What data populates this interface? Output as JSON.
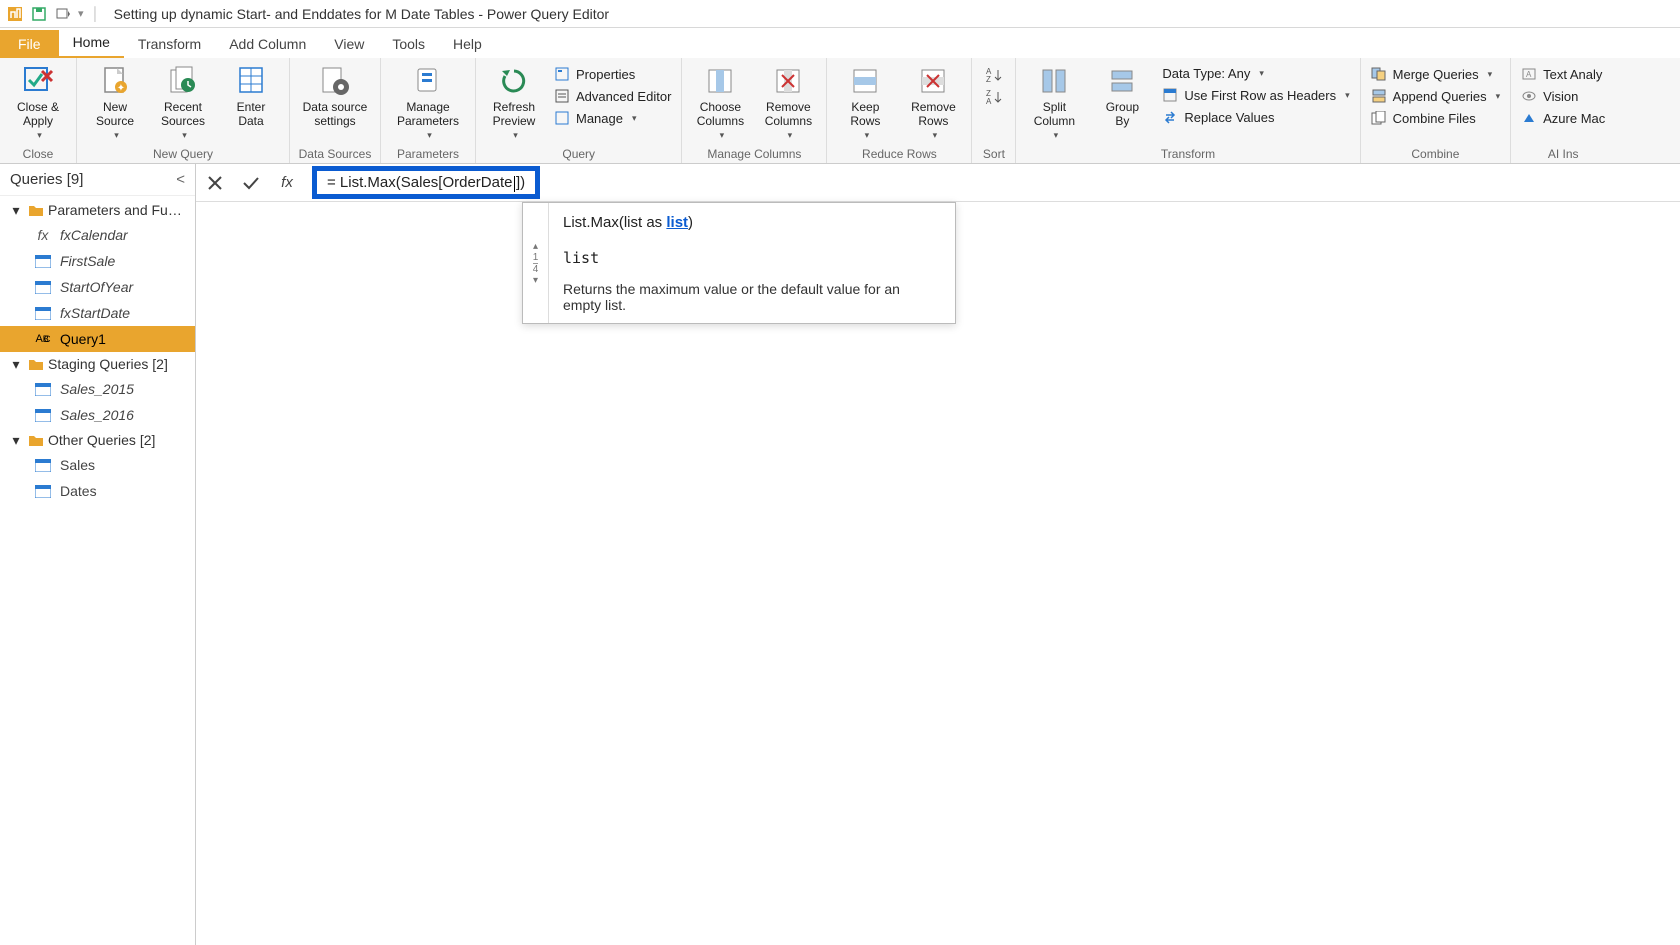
{
  "titlebar": {
    "title": "Setting up dynamic Start- and Enddates for M Date Tables - Power Query Editor"
  },
  "tabs": {
    "file": "File",
    "home": "Home",
    "transform": "Transform",
    "add_column": "Add Column",
    "view": "View",
    "tools": "Tools",
    "help": "Help"
  },
  "ribbon": {
    "close": {
      "close_apply": "Close &\nApply",
      "group": "Close"
    },
    "new_query": {
      "new_source": "New\nSource",
      "recent_sources": "Recent\nSources",
      "enter_data": "Enter\nData",
      "group": "New Query"
    },
    "data_sources": {
      "settings": "Data source\nsettings",
      "group": "Data Sources"
    },
    "parameters": {
      "manage": "Manage\nParameters",
      "group": "Parameters"
    },
    "query": {
      "refresh": "Refresh\nPreview",
      "properties": "Properties",
      "advanced": "Advanced Editor",
      "manage": "Manage",
      "group": "Query"
    },
    "manage_columns": {
      "choose": "Choose\nColumns",
      "remove": "Remove\nColumns",
      "group": "Manage Columns"
    },
    "reduce_rows": {
      "keep": "Keep\nRows",
      "remove": "Remove\nRows",
      "group": "Reduce Rows"
    },
    "sort": {
      "group": "Sort"
    },
    "transform_grp": {
      "split": "Split\nColumn",
      "group_by": "Group\nBy",
      "datatype": "Data Type: Any",
      "first_row": "Use First Row as Headers",
      "replace": "Replace Values",
      "group": "Transform"
    },
    "combine": {
      "merge": "Merge Queries",
      "append": "Append Queries",
      "combine_files": "Combine Files",
      "group": "Combine"
    },
    "ai": {
      "text": "Text Analy",
      "vision": "Vision",
      "azure": "Azure Mac",
      "group": "AI Ins"
    }
  },
  "queries": {
    "header": "Queries [9]",
    "folders": {
      "params": "Parameters and Fu…",
      "staging": "Staging Queries [2]",
      "other": "Other Queries [2]"
    },
    "items": {
      "fxCalendar": "fxCalendar",
      "FirstSale": "FirstSale",
      "StartOfYear": "StartOfYear",
      "fxStartDate": "fxStartDate",
      "Query1": "Query1",
      "Sales_2015": "Sales_2015",
      "Sales_2016": "Sales_2016",
      "Sales": "Sales",
      "Dates": "Dates"
    }
  },
  "formula": {
    "prefix": "= List.Max(Sales[OrderDate",
    "suffix": "])"
  },
  "intellisense": {
    "sig_pre": "List.Max(list as ",
    "sig_kw": "list",
    "sig_post": ")",
    "param": "list",
    "desc": "Returns the maximum value or the default value for an empty list.",
    "nav_frac_top": "1",
    "nav_frac_bot": "4"
  }
}
